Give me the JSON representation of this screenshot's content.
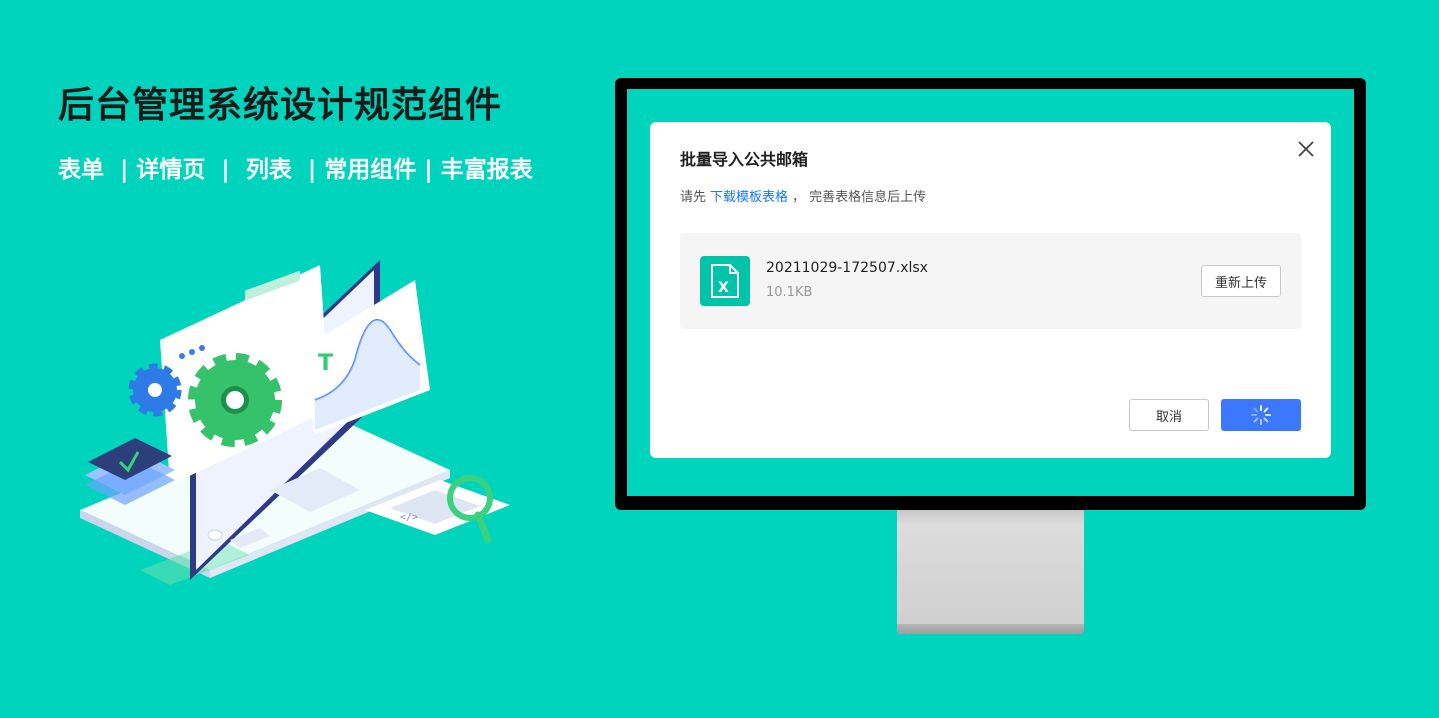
{
  "hero": {
    "title": "后台管理系统设计规范组件",
    "subtitle": "表单  | 详情页  |  列表  | 常用组件 | 丰富报表"
  },
  "dialog": {
    "title": "批量导入公共邮箱",
    "hint_prefix": "请先",
    "hint_link": "下载模板表格",
    "hint_suffix": "，  完善表格信息后上传",
    "file": {
      "name": "20211029-172507.xlsx",
      "size": "10.1KB",
      "icon": "excel-file-icon"
    },
    "reupload_label": "重新上传",
    "cancel_label": "取消",
    "confirm_state": "loading"
  },
  "colors": {
    "background": "#00d4bc",
    "primary": "#3c78ff",
    "link": "#1677ff",
    "file_icon": "#00c4a7"
  }
}
